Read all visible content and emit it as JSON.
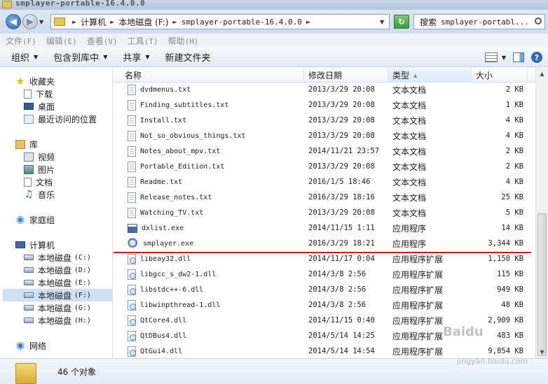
{
  "window": {
    "title": "smplayer-portable-16.4.0.0"
  },
  "address": {
    "segments": [
      "计算机",
      "本地磁盘 (F:)",
      "smplayer-portable-16.4.0.0"
    ]
  },
  "search": {
    "label": "搜索",
    "value": "smplayer-portabl..."
  },
  "menubar": [
    {
      "label": "文件",
      "key": "(F)"
    },
    {
      "label": "编辑",
      "key": "(E)"
    },
    {
      "label": "查看",
      "key": "(V)"
    },
    {
      "label": "工具",
      "key": "(T)"
    },
    {
      "label": "帮助",
      "key": "(H)"
    }
  ],
  "toolbar": {
    "organize": "组织",
    "include": "包含到库中",
    "share": "共享",
    "new_folder": "新建文件夹"
  },
  "nav": {
    "favorites": "收藏夹",
    "downloads": "下载",
    "desktop": "桌面",
    "recent": "最近访问的位置",
    "libraries": "库",
    "videos": "视频",
    "pictures": "图片",
    "documents": "文档",
    "music": "音乐",
    "homegroup": "家庭组",
    "computer": "计算机",
    "drives": [
      {
        "label": "本地磁盘",
        "letter": "(C:)"
      },
      {
        "label": "本地磁盘",
        "letter": "(D:)"
      },
      {
        "label": "本地磁盘",
        "letter": "(E:)"
      },
      {
        "label": "本地磁盘",
        "letter": "(F:)"
      },
      {
        "label": "本地磁盘",
        "letter": "(G:)"
      },
      {
        "label": "本地磁盘",
        "letter": "(H:)"
      }
    ],
    "network": "网络"
  },
  "columns": {
    "name": "名称",
    "modified": "修改日期",
    "type": "类型",
    "size": "大小"
  },
  "files": [
    {
      "name": "dvdmenus.txt",
      "date": "2013/3/29 20:08",
      "type": "文本文档",
      "size": "2 KB",
      "icon": "txt"
    },
    {
      "name": "Finding_subtitles.txt",
      "date": "2013/3/29 20:08",
      "type": "文本文档",
      "size": "1 KB",
      "icon": "txt"
    },
    {
      "name": "Install.txt",
      "date": "2013/3/29 20:08",
      "type": "文本文档",
      "size": "4 KB",
      "icon": "txt"
    },
    {
      "name": "Not_so_obvious_things.txt",
      "date": "2013/3/29 20:08",
      "type": "文本文档",
      "size": "4 KB",
      "icon": "txt"
    },
    {
      "name": "Notes_about_mpv.txt",
      "date": "2014/11/21 23:57",
      "type": "文本文档",
      "size": "2 KB",
      "icon": "txt"
    },
    {
      "name": "Portable_Edition.txt",
      "date": "2013/3/29 20:08",
      "type": "文本文档",
      "size": "2 KB",
      "icon": "txt"
    },
    {
      "name": "Readme.txt",
      "date": "2016/1/5 18:46",
      "type": "文本文档",
      "size": "4 KB",
      "icon": "txt"
    },
    {
      "name": "Release_notes.txt",
      "date": "2016/3/29 18:16",
      "type": "文本文档",
      "size": "25 KB",
      "icon": "txt"
    },
    {
      "name": "Watching_TV.txt",
      "date": "2013/3/29 20:08",
      "type": "文本文档",
      "size": "5 KB",
      "icon": "txt"
    },
    {
      "name": "dxlist.exe",
      "date": "2014/11/15 1:11",
      "type": "应用程序",
      "size": "14 KB",
      "icon": "exe"
    },
    {
      "name": "smplayer.exe",
      "date": "2016/3/29 18:21",
      "type": "应用程序",
      "size": "3,344 KB",
      "icon": "exe2"
    },
    {
      "name": "libeay32.dll",
      "date": "2014/11/17 0:04",
      "type": "应用程序扩展",
      "size": "1,150 KB",
      "icon": "dll"
    },
    {
      "name": "libgcc_s_dw2-1.dll",
      "date": "2014/3/8 2:56",
      "type": "应用程序扩展",
      "size": "115 KB",
      "icon": "dll"
    },
    {
      "name": "libstdc++-6.dll",
      "date": "2014/3/8 2:56",
      "type": "应用程序扩展",
      "size": "949 KB",
      "icon": "dll"
    },
    {
      "name": "libwinpthread-1.dll",
      "date": "2014/3/8 2:56",
      "type": "应用程序扩展",
      "size": "48 KB",
      "icon": "dll"
    },
    {
      "name": "QtCore4.dll",
      "date": "2014/11/15 0:40",
      "type": "应用程序扩展",
      "size": "2,909 KB",
      "icon": "dll"
    },
    {
      "name": "QtDBus4.dll",
      "date": "2014/5/14 14:25",
      "type": "应用程序扩展",
      "size": "483 KB",
      "icon": "dll"
    },
    {
      "name": "QtGui4.dll",
      "date": "2014/5/14 14:54",
      "type": "应用程序扩展",
      "size": "9,854 KB",
      "icon": "dll"
    }
  ],
  "status": {
    "count": "46 个对象"
  },
  "watermark": {
    "main": "Baidu",
    "sub": "jingyan.baidu.com"
  }
}
